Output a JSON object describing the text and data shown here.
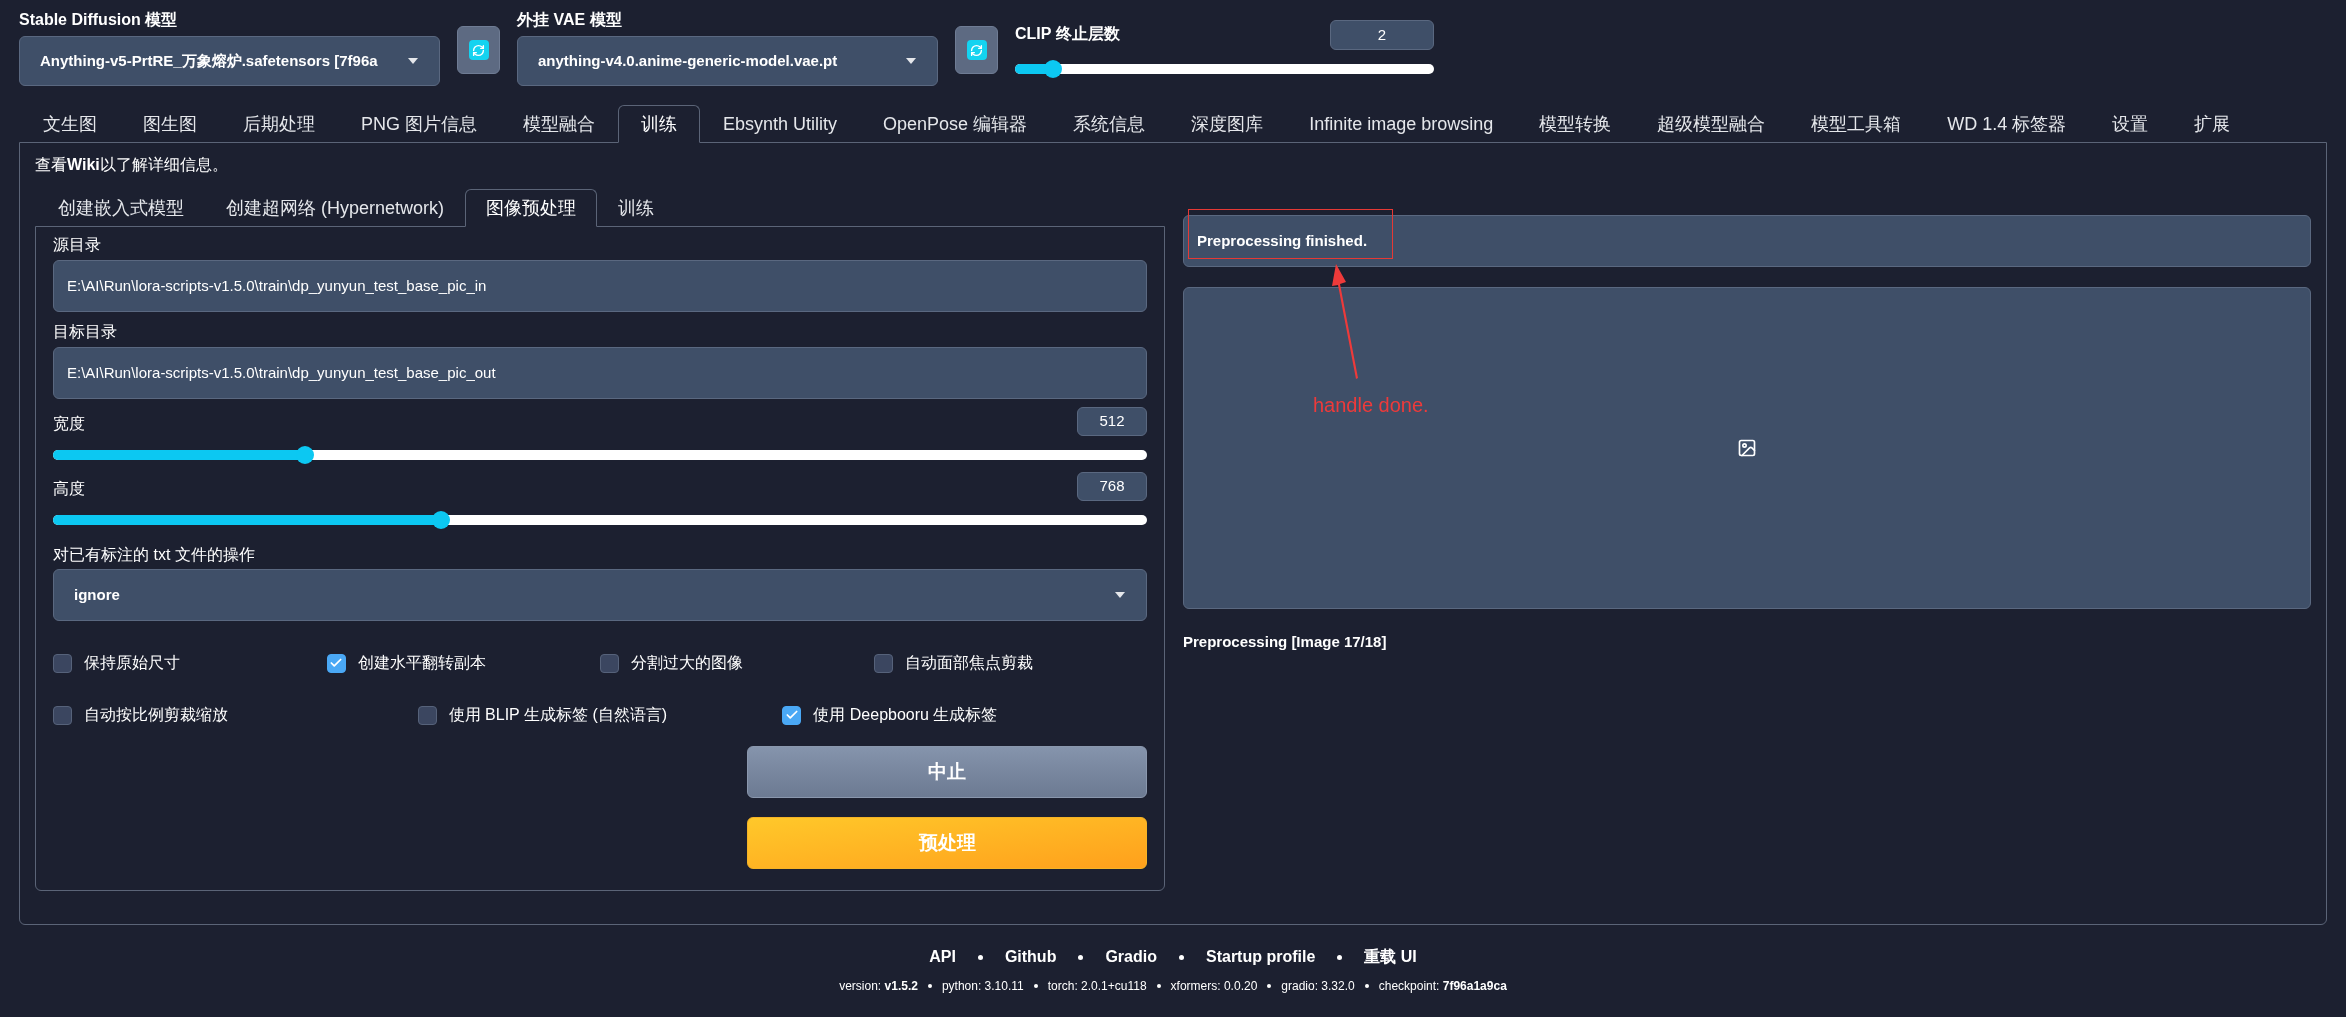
{
  "model_selectors": [
    {
      "label": "Stable Diffusion 模型",
      "value": "Anything-v5-PrtRE_万象熔炉.safetensors [7f96a"
    },
    {
      "label": "外挂 VAE 模型",
      "value": "anything-v4.0.anime-generic-model.vae.pt"
    }
  ],
  "clip_skip": {
    "label": "CLIP 终止层数",
    "value": "2",
    "level": 0.09
  },
  "tabs": [
    {
      "label": "文生图",
      "selected": false
    },
    {
      "label": "图生图",
      "selected": false
    },
    {
      "label": "后期处理",
      "selected": false
    },
    {
      "label": "PNG 图片信息",
      "selected": false
    },
    {
      "label": "模型融合",
      "selected": false
    },
    {
      "label": "训练",
      "selected": true
    },
    {
      "label": "Ebsynth Utility",
      "selected": false
    },
    {
      "label": "OpenPose 编辑器",
      "selected": false
    },
    {
      "label": "系统信息",
      "selected": false
    },
    {
      "label": "深度图库",
      "selected": false
    },
    {
      "label": "Infinite image browsing",
      "selected": false
    },
    {
      "label": "模型转换",
      "selected": false
    },
    {
      "label": "超级模型融合",
      "selected": false
    },
    {
      "label": "模型工具箱",
      "selected": false
    },
    {
      "label": "WD 1.4 标签器",
      "selected": false
    },
    {
      "label": "设置",
      "selected": false
    },
    {
      "label": "扩展",
      "selected": false
    }
  ],
  "wiki_note": "查看**Wiki**以了解详细信息。",
  "sub_tabs": [
    {
      "label": "创建嵌入式模型",
      "selected": false
    },
    {
      "label": "创建超网络 (Hypernetwork)",
      "selected": false
    },
    {
      "label": "图像预处理",
      "selected": true
    },
    {
      "label": "训练",
      "selected": false
    }
  ],
  "preprocess": {
    "fields": [
      {
        "label": "源目录",
        "value": "E:\\AI\\Run\\lora-scripts-v1.5.0\\train\\dp_yunyun_test_base_pic_in"
      },
      {
        "label": "目标目录",
        "value": "E:\\AI\\Run\\lora-scripts-v1.5.0\\train\\dp_yunyun_test_base_pic_out"
      }
    ],
    "sliders": [
      {
        "label": "宽度",
        "value": "512",
        "level": 0.23
      },
      {
        "label": "高度",
        "value": "768",
        "level": 0.355
      }
    ],
    "existing_caption": {
      "label": "对已有标注的 txt 文件的操作",
      "value": "ignore"
    },
    "option_rows": [
      {
        "options": [
          {
            "label": "保持原始尺寸",
            "checked": false
          },
          {
            "label": "创建水平翻转副本",
            "checked": true
          },
          {
            "label": "分割过大的图像",
            "checked": false
          },
          {
            "label": "自动面部焦点剪裁",
            "checked": false
          }
        ]
      },
      {
        "options": [
          {
            "label": "自动按比例剪裁缩放",
            "checked": false
          },
          {
            "label": "使用 BLIP 生成标签 (自然语言)",
            "checked": false
          },
          {
            "label": "使用 Deepbooru 生成标签",
            "checked": true
          }
        ]
      }
    ],
    "buttons": [
      {
        "label": "中止",
        "kind": "secondary"
      },
      {
        "label": "预处理",
        "kind": "primary"
      }
    ]
  },
  "output": {
    "status": "Preprocessing finished.",
    "progress": "Preprocessing [Image 17/18]"
  },
  "annotation": {
    "text": "handle done."
  },
  "footer": {
    "links": [
      "API",
      "Github",
      "Gradio",
      "Startup profile",
      "重载 UI"
    ],
    "versions": [
      "version: **v1.5.2**",
      "python: 3.10.11",
      "torch: 2.0.1+cu118",
      "xformers: 0.0.20",
      "gradio: 3.32.0",
      "checkpoint: **7f96a1a9ca**"
    ]
  }
}
